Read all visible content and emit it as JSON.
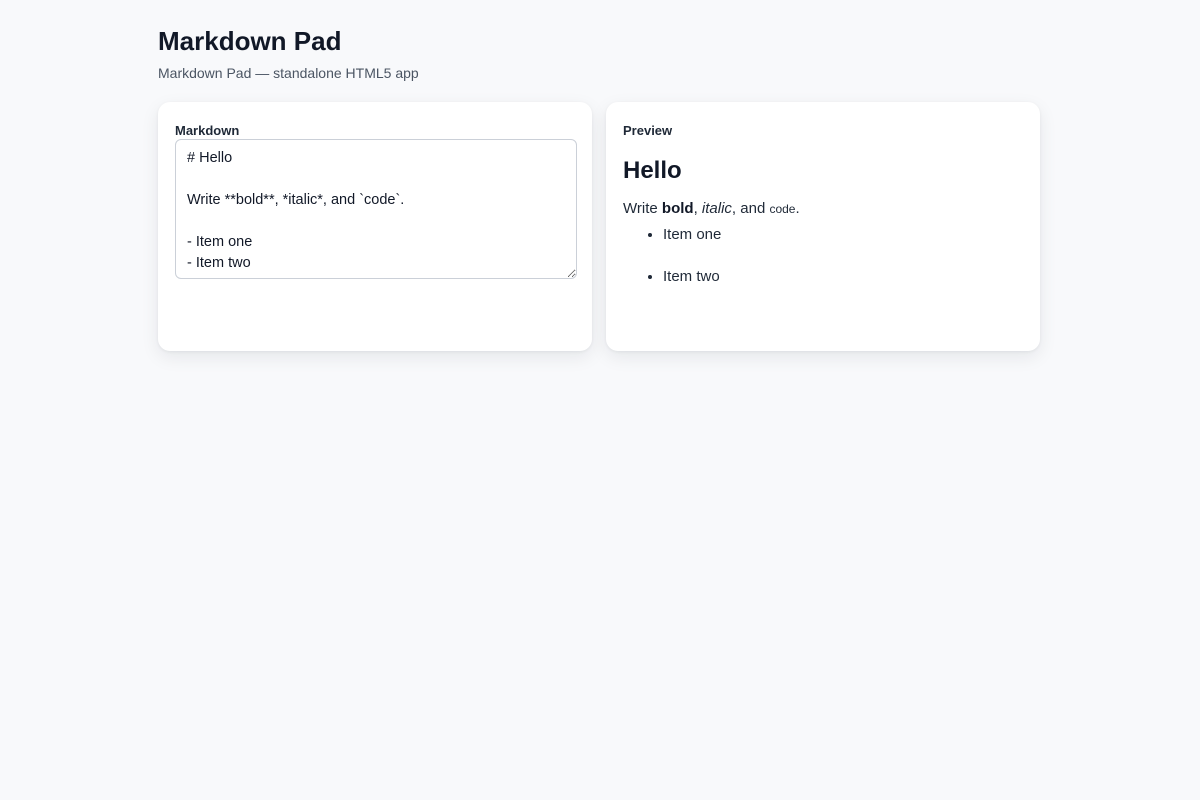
{
  "app": {
    "title": "Markdown Pad",
    "subtitle": "Markdown Pad — standalone HTML5 app"
  },
  "editor": {
    "label": "Markdown",
    "value": "# Hello\n\nWrite **bold**, *italic*, and `code`.\n\n- Item one\n- Item two"
  },
  "preview": {
    "label": "Preview",
    "heading": "Hello",
    "paragraph": {
      "prefix": "Write ",
      "bold": "bold",
      "sep1": ", ",
      "italic": "italic",
      "sep2": ", and ",
      "code": "code",
      "suffix": "."
    },
    "items": [
      "Item one",
      "Item two"
    ]
  }
}
